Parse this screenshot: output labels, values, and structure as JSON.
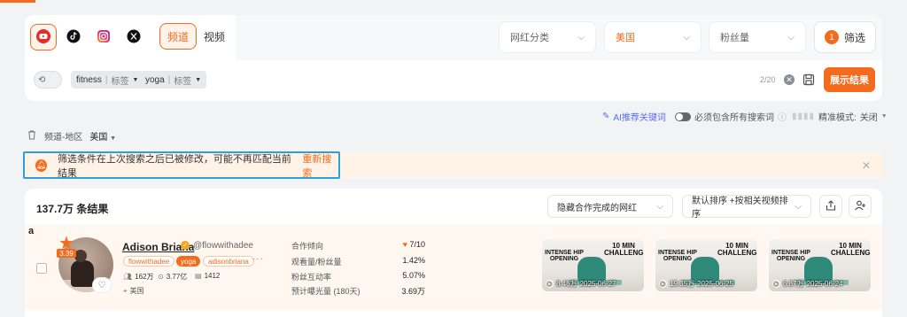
{
  "platforms": {
    "icons": [
      "youtube-icon",
      "tiktok-icon",
      "instagram-icon",
      "x-icon"
    ],
    "active": "youtube"
  },
  "content_type": {
    "channel_label": "频道",
    "video_label": "视频"
  },
  "filters": {
    "category": {
      "label": "网红分类"
    },
    "country": {
      "label": "美国"
    },
    "followers": {
      "label": "粉丝量"
    },
    "filter_button": {
      "count": "1",
      "label": "筛选"
    }
  },
  "search": {
    "tags": [
      {
        "text": "fitness",
        "kind": "标签"
      },
      {
        "text": "yoga",
        "kind": "标签"
      }
    ],
    "counter": "2/20",
    "show_results_label": "展示结果"
  },
  "options": {
    "ai_keywords_label": "AI推荐关键词",
    "must_include_label": "必须包含所有搜索词",
    "precision_label": "精准模式:",
    "precision_value": "关闭"
  },
  "region": {
    "label": "频道-地区",
    "value": "美国"
  },
  "alert": {
    "message": "筛选条件在上次搜索之后已被修改，可能不再匹配当前结果",
    "action": "重新搜索"
  },
  "results": {
    "count_label": "137.7万 条结果",
    "hide_completed_label": "隐藏合作完成的网红",
    "sort_label": "默认排序 +按相关视频排序"
  },
  "influencer": {
    "row_letter": "a",
    "score": "3.39",
    "name": "Adison Briana",
    "handle": "@flowwithadee",
    "chips": [
      "flowwithadee",
      "yoga",
      "adisonbriana"
    ],
    "more": "···",
    "followers": "162万",
    "views": "3.77亿",
    "videos": "1412",
    "location": "美国",
    "metrics": [
      {
        "label": "合作倾向",
        "value": "7/10"
      },
      {
        "label": "观看量/粉丝量",
        "value": "1.42%"
      },
      {
        "label": "粉丝互动率",
        "value": "5.07%"
      },
      {
        "label": "预计曝光量 (180天)",
        "value": "3.69万"
      }
    ],
    "videos_list": [
      {
        "title_left": "INTENSE HIP OPENING",
        "title_right": "10 MIN CHALLENGE",
        "views": "8.46万",
        "date": "2025-06-27"
      },
      {
        "title_left": "INTENSE HIP OPENING",
        "title_right": "10 MIN CHALLENGE",
        "views": "19.35万",
        "date": "2025-06-25"
      },
      {
        "title_left": "INTENSE HIP OPENING",
        "title_right": "10 MIN CHALLENGE",
        "views": "6.87万",
        "date": "2025-06-24"
      }
    ]
  }
}
